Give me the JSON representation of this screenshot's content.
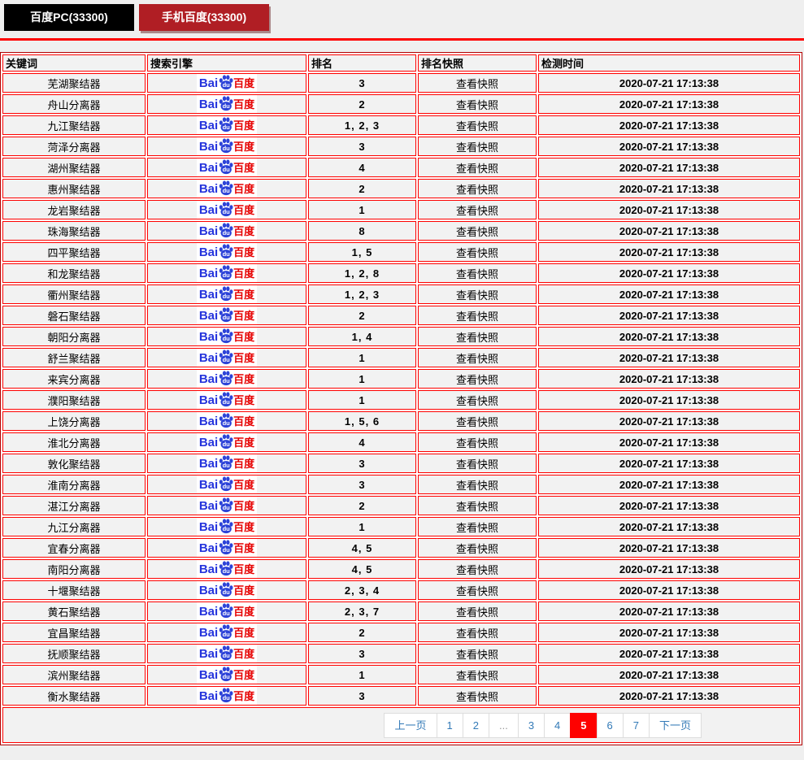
{
  "tabs": [
    {
      "label": "百度PC(33300)"
    },
    {
      "label": "手机百度(33300)"
    }
  ],
  "table": {
    "headers": [
      "关键词",
      "搜索引擎",
      "排名",
      "排名快照",
      "检测时间"
    ],
    "snapshot_label": "查看快照",
    "logo": {
      "bai": "Bai",
      "du": "du",
      "cn": "百度"
    },
    "rows": [
      {
        "keyword": "芜湖聚结器",
        "rank": "3",
        "time": "2020-07-21 17:13:38"
      },
      {
        "keyword": "舟山分离器",
        "rank": "2",
        "time": "2020-07-21 17:13:38"
      },
      {
        "keyword": "九江聚结器",
        "rank": "1, 2, 3",
        "time": "2020-07-21 17:13:38"
      },
      {
        "keyword": "菏泽分离器",
        "rank": "3",
        "time": "2020-07-21 17:13:38"
      },
      {
        "keyword": "湖州聚结器",
        "rank": "4",
        "time": "2020-07-21 17:13:38"
      },
      {
        "keyword": "惠州聚结器",
        "rank": "2",
        "time": "2020-07-21 17:13:38"
      },
      {
        "keyword": "龙岩聚结器",
        "rank": "1",
        "time": "2020-07-21 17:13:38"
      },
      {
        "keyword": "珠海聚结器",
        "rank": "8",
        "time": "2020-07-21 17:13:38"
      },
      {
        "keyword": "四平聚结器",
        "rank": "1, 5",
        "time": "2020-07-21 17:13:38"
      },
      {
        "keyword": "和龙聚结器",
        "rank": "1, 2, 8",
        "time": "2020-07-21 17:13:38"
      },
      {
        "keyword": "衢州聚结器",
        "rank": "1, 2, 3",
        "time": "2020-07-21 17:13:38"
      },
      {
        "keyword": "磐石聚结器",
        "rank": "2",
        "time": "2020-07-21 17:13:38"
      },
      {
        "keyword": "朝阳分离器",
        "rank": "1, 4",
        "time": "2020-07-21 17:13:38"
      },
      {
        "keyword": "舒兰聚结器",
        "rank": "1",
        "time": "2020-07-21 17:13:38"
      },
      {
        "keyword": "来宾分离器",
        "rank": "1",
        "time": "2020-07-21 17:13:38"
      },
      {
        "keyword": "濮阳聚结器",
        "rank": "1",
        "time": "2020-07-21 17:13:38"
      },
      {
        "keyword": "上饶分离器",
        "rank": "1, 5, 6",
        "time": "2020-07-21 17:13:38"
      },
      {
        "keyword": "淮北分离器",
        "rank": "4",
        "time": "2020-07-21 17:13:38"
      },
      {
        "keyword": "敦化聚结器",
        "rank": "3",
        "time": "2020-07-21 17:13:38"
      },
      {
        "keyword": "淮南分离器",
        "rank": "3",
        "time": "2020-07-21 17:13:38"
      },
      {
        "keyword": "湛江分离器",
        "rank": "2",
        "time": "2020-07-21 17:13:38"
      },
      {
        "keyword": "九江分离器",
        "rank": "1",
        "time": "2020-07-21 17:13:38"
      },
      {
        "keyword": "宜春分离器",
        "rank": "4, 5",
        "time": "2020-07-21 17:13:38"
      },
      {
        "keyword": "南阳分离器",
        "rank": "4, 5",
        "time": "2020-07-21 17:13:38"
      },
      {
        "keyword": "十堰聚结器",
        "rank": "2, 3, 4",
        "time": "2020-07-21 17:13:38"
      },
      {
        "keyword": "黄石聚结器",
        "rank": "2, 3, 7",
        "time": "2020-07-21 17:13:38"
      },
      {
        "keyword": "宜昌聚结器",
        "rank": "2",
        "time": "2020-07-21 17:13:38"
      },
      {
        "keyword": "抚顺聚结器",
        "rank": "3",
        "time": "2020-07-21 17:13:38"
      },
      {
        "keyword": "滨州聚结器",
        "rank": "1",
        "time": "2020-07-21 17:13:38"
      },
      {
        "keyword": "衡水聚结器",
        "rank": "3",
        "time": "2020-07-21 17:13:38"
      }
    ]
  },
  "pagination": {
    "prev_label": "上一页",
    "next_label": "下一页",
    "ellipsis": "...",
    "pages": [
      "1",
      "2",
      "...",
      "3",
      "4",
      "5",
      "6",
      "7"
    ],
    "active_page": "5"
  },
  "colors": {
    "accent_red": "#fe0100",
    "tab_black": "#000000",
    "tab_red": "#b01e24",
    "link_blue": "#337ab7",
    "baidu_blue": "#2534dc",
    "baidu_red": "#e60000",
    "cell_bg": "#f2f2f2",
    "page_bg": "#efefef"
  }
}
